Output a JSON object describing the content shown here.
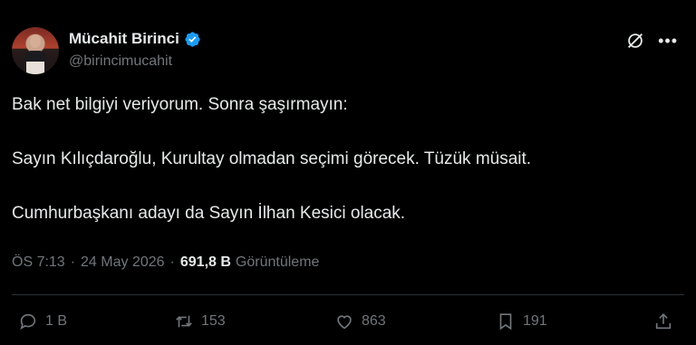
{
  "author": {
    "display_name": "Mücahit Birinci",
    "handle": "@birincimucahit",
    "verified": true,
    "verified_color": "#1d9bf0"
  },
  "tweet": {
    "paragraphs": [
      "Bak net bilgiyi veriyorum. Sonra şaşırmayın:",
      "Sayın Kılıçdaroğlu, Kurultay olmadan seçimi görecek. Tüzük müsait.",
      "Cumhurbaşkanı adayı da Sayın İlhan Kesici olacak."
    ]
  },
  "meta": {
    "time": "ÖS 7:13",
    "separator": "·",
    "date": "24 May 2026",
    "views_count": "691,8 B",
    "views_label": "Görüntüleme"
  },
  "actions": {
    "replies": "1 B",
    "reposts": "153",
    "likes": "863",
    "bookmarks": "191"
  },
  "icons": [
    "grok-icon",
    "more-icon",
    "verified-badge-icon",
    "reply-icon",
    "repost-icon",
    "like-icon",
    "bookmark-icon",
    "share-icon"
  ],
  "colors": {
    "background": "#000000",
    "text": "#e7e9ea",
    "muted": "#71767b",
    "accent": "#1d9bf0"
  }
}
